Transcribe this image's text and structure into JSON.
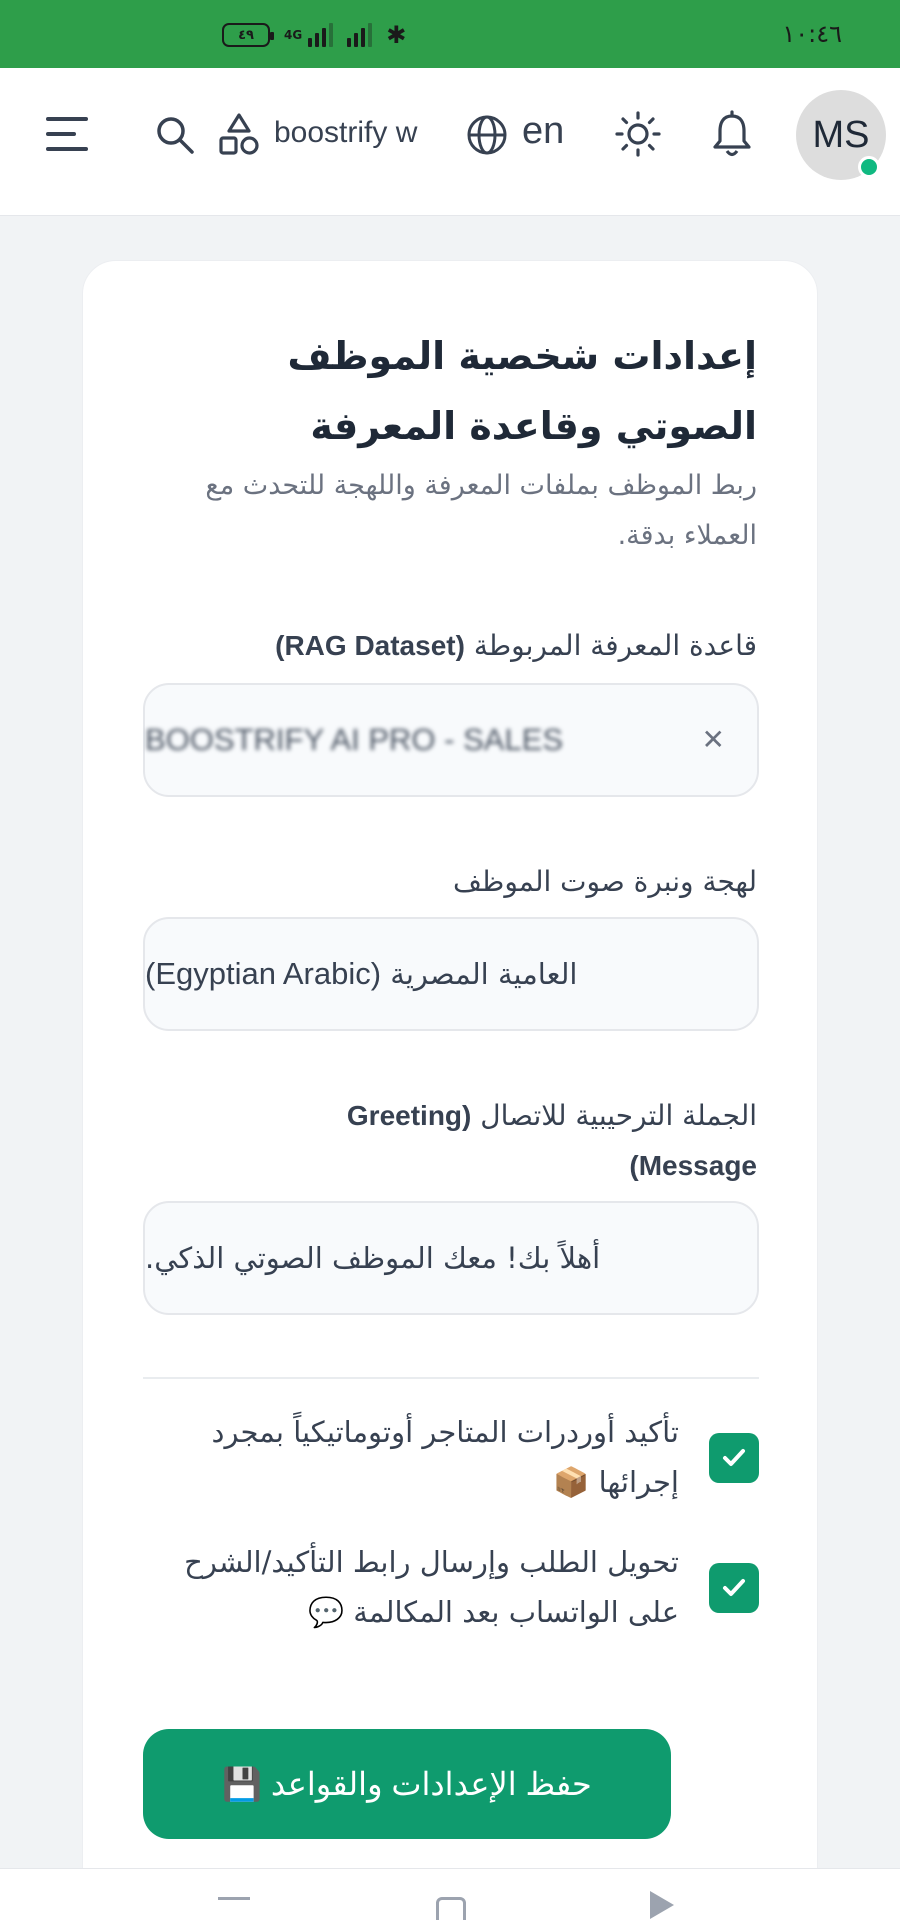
{
  "status_bar": {
    "time": "١٠:٤٦",
    "battery": "٤٩",
    "network": "4G"
  },
  "header": {
    "workspace": "boostrify w",
    "language": "en",
    "avatar_initials": "MS",
    "icons": [
      "menu-icon",
      "search-icon",
      "shapes-icon",
      "globe-icon",
      "sun-icon",
      "bell-icon"
    ]
  },
  "card": {
    "title": "إعدادات شخصية الموظف الصوتي وقاعدة المعرفة",
    "subtitle": "ربط الموظف بملفات المعرفة واللهجة للتحدث مع العملاء بدقة.",
    "dataset": {
      "label_ar": "قاعدة المعرفة المربوطة",
      "label_en": "(RAG Dataset)",
      "value": "BOOSTRIFY AI PRO - SALES"
    },
    "dialect": {
      "label": "لهجة ونبرة صوت الموظف",
      "value_ar": "العامية المصرية",
      "value_en": "(Egyptian Arabic)"
    },
    "greeting": {
      "label_ar": "الجملة الترحيبية للاتصال",
      "label_en_1": "(Greeting",
      "label_en_2": "Message)",
      "value": "أهلاً بك! معك الموظف الصوتي الذكي."
    },
    "options": [
      {
        "label": "تأكيد أوردرات المتاجر أوتوماتيكياً بمجرد إجرائها 📦",
        "checked": true
      },
      {
        "label": "تحويل الطلب وإرسال رابط التأكيد/الشرح على الواتساب بعد المكالمة 💬",
        "checked": true
      }
    ],
    "save_button": "حفظ الإعدادات والقواعد 💾"
  },
  "colors": {
    "status_bar": "#2e9e4a",
    "accent": "#0f9b6e",
    "online": "#10b981"
  }
}
